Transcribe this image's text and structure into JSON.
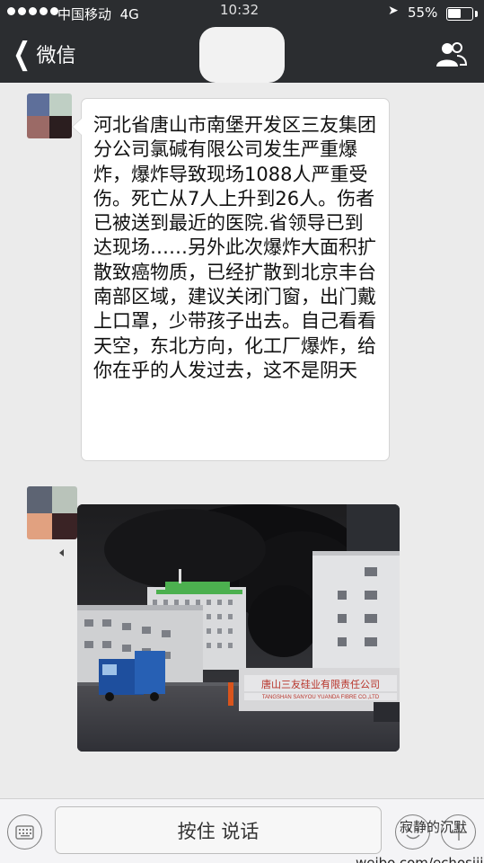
{
  "status_bar": {
    "carrier": "中国移动",
    "network": "4G",
    "time": "10:32",
    "battery": "55%",
    "battery_level": 0.55
  },
  "nav": {
    "back_label": "微信"
  },
  "messages": [
    {
      "type": "text",
      "text": "河北省唐山市南堡开发区三友集团分公司氯碱有限公司发生严重爆炸，爆炸导致现场1088人严重受伤。死亡从7人上升到26人。伤者已被送到最近的医院.省领导已到达现场……另外此次爆炸大面积扩散致癌物质，已经扩散到北京丰台南部区域，建议关闭门窗，出门戴上口罩，少带孩子出去。自己看看天空，东北方向，化工厂爆炸，给你在乎的人发过去，这不是阴天",
      "avatar_colors": [
        "#5e6f9a",
        "#bfcfc4",
        "#9b6a66",
        "#2b1e1f"
      ]
    },
    {
      "type": "image",
      "sign_text": "唐山三友硅业有限责任公司",
      "sign_subtext": "TANGSHAN SANYOU YUANDA FIBRE CO.,LTD",
      "avatar_colors": [
        "#5d6473",
        "#b9c3ba",
        "#e1a180",
        "#3a2325"
      ]
    }
  ],
  "input_bar": {
    "hold_to_talk": "按住 说话"
  },
  "watermark": {
    "text": "weibo.com/echosijie",
    "logo_text": "寂静的沉默"
  },
  "icons": {
    "back": "chevron-left-icon",
    "contacts": "contacts-icon",
    "keyboard": "keyboard-icon",
    "emoji": "emoji-icon",
    "plus": "plus-icon",
    "location": "location-arrow-icon"
  }
}
